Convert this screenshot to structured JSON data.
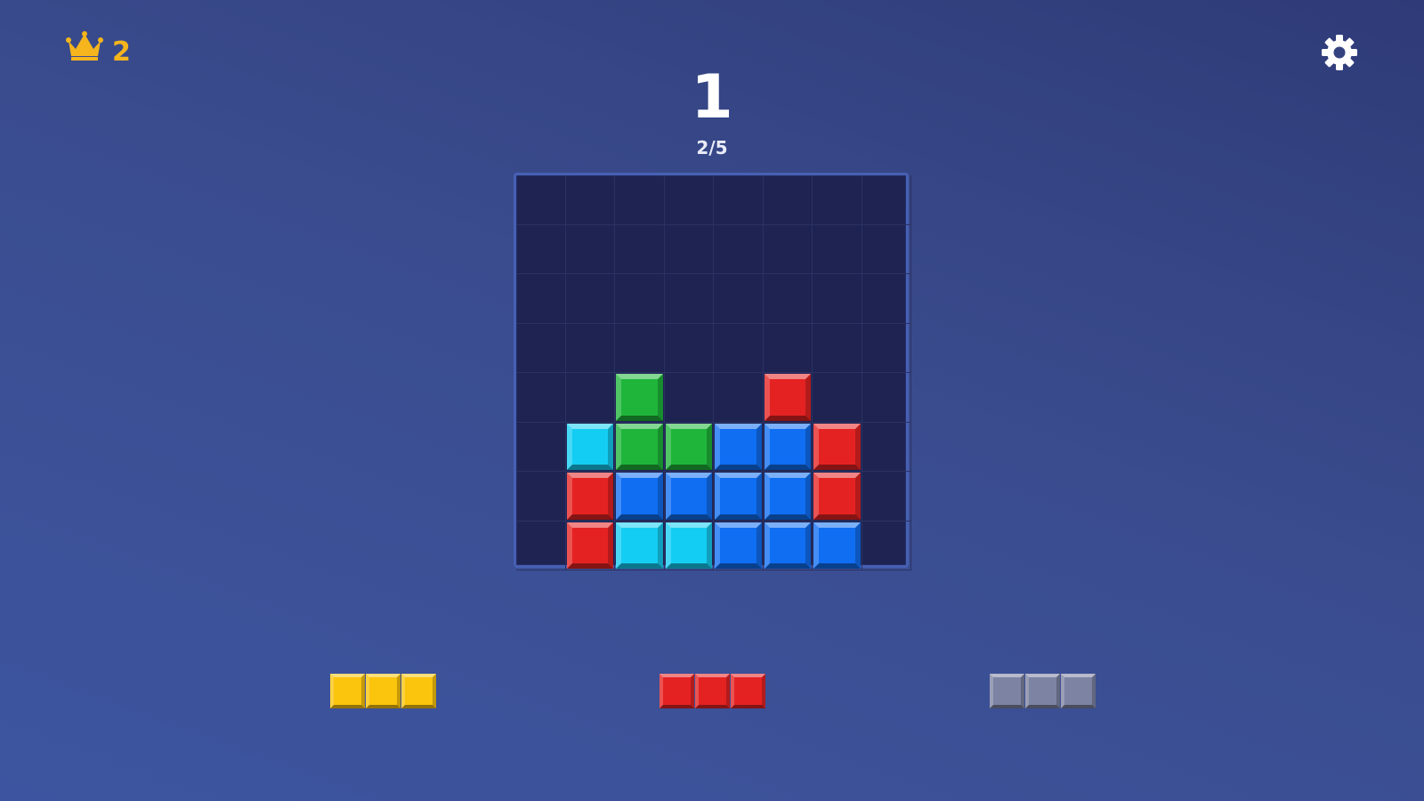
{
  "best": {
    "icon": "crown-icon",
    "value": "2",
    "color": "#f6b51c"
  },
  "settings": {
    "icon": "gear-icon"
  },
  "score": {
    "value": "1"
  },
  "level": {
    "progress": "2/5"
  },
  "colors": {
    "green": "#1fb53b",
    "red": "#e52222",
    "cyan": "#14cdf2",
    "blue": "#0f6ef2",
    "yellow": "#fbc40d",
    "gray": "#7d84a3"
  },
  "board": {
    "rows": 8,
    "cols": 8,
    "cells": [
      [
        null,
        null,
        null,
        null,
        null,
        null,
        null,
        null
      ],
      [
        null,
        null,
        null,
        null,
        null,
        null,
        null,
        null
      ],
      [
        null,
        null,
        null,
        null,
        null,
        null,
        null,
        null
      ],
      [
        null,
        null,
        null,
        null,
        null,
        null,
        null,
        null
      ],
      [
        null,
        null,
        "green",
        null,
        null,
        "red",
        null,
        null
      ],
      [
        null,
        "cyan",
        "green",
        "green",
        "blue",
        "blue",
        "red",
        null
      ],
      [
        null,
        "red",
        "blue",
        "blue",
        "blue",
        "blue",
        "red",
        null
      ],
      [
        null,
        "red",
        "cyan",
        "cyan",
        "blue",
        "blue",
        "blue",
        null
      ]
    ]
  },
  "tray": {
    "pieces": [
      {
        "color": "yellow",
        "cells": 3
      },
      {
        "color": "red",
        "cells": 3
      },
      {
        "color": "gray",
        "cells": 3
      }
    ]
  }
}
